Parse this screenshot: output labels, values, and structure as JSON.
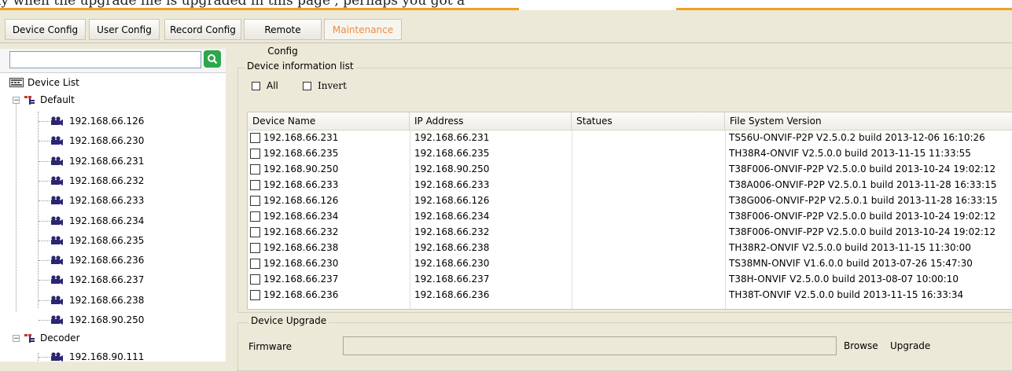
{
  "banner": {
    "text": "ly when the upgrade file is upgraded in this page , perhaps you got a"
  },
  "tabs": [
    {
      "label": "Device Config"
    },
    {
      "label": "User Config"
    },
    {
      "label": "Record Config"
    },
    {
      "label": "Remote Config"
    },
    {
      "label": "Maintenance",
      "active": true
    }
  ],
  "sidebar": {
    "search_placeholder": "",
    "root": "Device List",
    "groups": [
      {
        "name": "Default",
        "devices": [
          "192.168.66.126",
          "192.168.66.230",
          "192.168.66.231",
          "192.168.66.232",
          "192.168.66.233",
          "192.168.66.234",
          "192.168.66.235",
          "192.168.66.236",
          "192.168.66.237",
          "192.168.66.238",
          "192.168.90.250"
        ]
      },
      {
        "name": "Decoder",
        "devices": [
          "192.168.90.111"
        ]
      }
    ]
  },
  "device_info": {
    "legend": "Device information list",
    "all_label": "All",
    "invert_label": "Invert",
    "columns": [
      "Device Name",
      "IP Address",
      "Statues",
      "File System Version"
    ],
    "rows": [
      {
        "name": "192.168.66.231",
        "ip": "192.168.66.231",
        "status": "",
        "version": "TS56U-ONVIF-P2P V2.5.0.2 build 2013-12-06 16:10:26"
      },
      {
        "name": "192.168.66.235",
        "ip": "192.168.66.235",
        "status": "",
        "version": "TH38R4-ONVIF V2.5.0.0 build 2013-11-15 11:33:55"
      },
      {
        "name": "192.168.90.250",
        "ip": "192.168.90.250",
        "status": "",
        "version": "T38F006-ONVIF-P2P V2.5.0.0 build 2013-10-24 19:02:12"
      },
      {
        "name": "192.168.66.233",
        "ip": "192.168.66.233",
        "status": "",
        "version": "T38A006-ONVIF-P2P V2.5.0.1 build 2013-11-28 16:33:15"
      },
      {
        "name": "192.168.66.126",
        "ip": "192.168.66.126",
        "status": "",
        "version": "T38G006-ONVIF-P2P V2.5.0.1 build 2013-11-28 16:33:15"
      },
      {
        "name": "192.168.66.234",
        "ip": "192.168.66.234",
        "status": "",
        "version": "T38F006-ONVIF-P2P V2.5.0.0 build 2013-10-24 19:02:12"
      },
      {
        "name": "192.168.66.232",
        "ip": "192.168.66.232",
        "status": "",
        "version": "T38F006-ONVIF-P2P V2.5.0.0 build 2013-10-24 19:02:12"
      },
      {
        "name": "192.168.66.238",
        "ip": "192.168.66.238",
        "status": "",
        "version": "TH38R2-ONVIF V2.5.0.0 build 2013-11-15 11:30:00"
      },
      {
        "name": "192.168.66.230",
        "ip": "192.168.66.230",
        "status": "",
        "version": "TS38MN-ONVIF V1.6.0.0 build 2013-07-26 15:47:30"
      },
      {
        "name": "192.168.66.237",
        "ip": "192.168.66.237",
        "status": "",
        "version": "T38H-ONVIF V2.5.0.0 build 2013-08-07 10:00:10"
      },
      {
        "name": "192.168.66.236",
        "ip": "192.168.66.236",
        "status": "",
        "version": "TH38T-ONVIF V2.5.0.0 build 2013-11-15 16:33:34"
      }
    ]
  },
  "upgrade": {
    "legend": "Device Upgrade",
    "firmware_label": "Firmware",
    "firmware_value": "",
    "browse_label": "Browse",
    "upgrade_label": "Upgrade"
  },
  "colors": {
    "accent": "#f28a3c",
    "search_button": "#2ca84a",
    "camera_icon": "#2b2670",
    "group_icon": "#c0392b",
    "tree_lines": "#999999"
  }
}
